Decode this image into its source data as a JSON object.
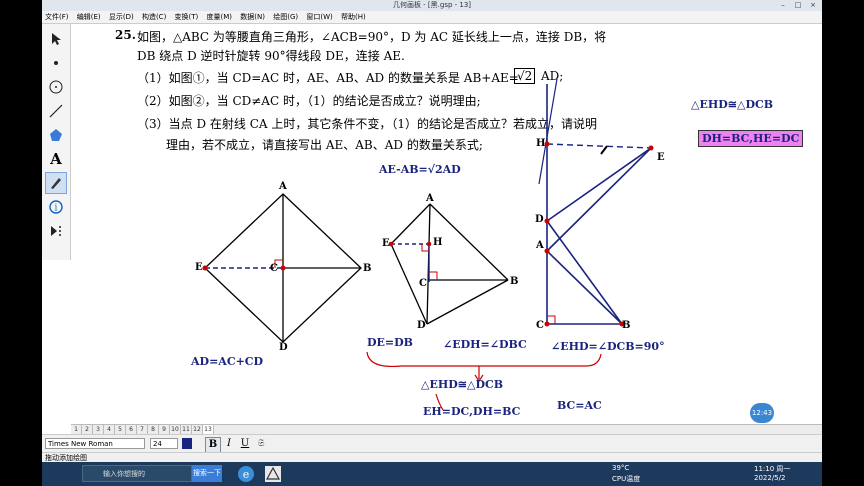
{
  "window": {
    "title": "几何画板 - [黑.gsp - 13]",
    "minimize": "–",
    "restore": "□",
    "close": "×"
  },
  "menu": [
    "文件(F)",
    "编辑(E)",
    "显示(D)",
    "构造(C)",
    "变换(T)",
    "度量(M)",
    "数据(N)",
    "绘图(G)",
    "窗口(W)",
    "帮助(H)"
  ],
  "tools": [
    "arrow-icon",
    "point-icon",
    "compass-icon",
    "line-icon",
    "polygon-icon",
    "text-icon",
    "marker-icon",
    "info-icon",
    "custom-tool-icon"
  ],
  "problem": {
    "number": "25.",
    "line1": "如图，△ABC 为等腰直角三角形，∠ACB=90°，D 为 AC 延长线上一点，连接 DB，将",
    "line2": "DB 绕点 D 逆时针旋转 90°得线段 DE，连接 AE.",
    "q1a": "（1）如图①，当 CD=AC 时，AE、AB、AD 的数量关系是 AB+AE=",
    "q1_answer": "√2",
    "q1b": "AD;",
    "q2": "（2）如图②，当 CD≠AC 时，（1）的结论是否成立？说明理由;",
    "q3a": "（3）当点 D 在射线 CA 上时，其它条件不变，（1）的结论是否成立？若成立，请说明",
    "q3b": "理由，若不成立，请直接写出 AE、AB、AD 的数量关系式;"
  },
  "notes": {
    "ae_ab": "AE-AB=√2AD",
    "ad": "AD=AC+CD",
    "de_db": "DE=DB",
    "edh_dbc": "∠EDH=∠DBC",
    "ehd_dcb_90": "∠EHD=∠DCB=90°",
    "ehd_cong_1": "△EHD≅△DCB",
    "eh_dc": "EH=DC,DH=BC",
    "bc_ac": "BC=AC",
    "ehd_cong_2": "△EHD≅△DCB",
    "highlight": "DH=BC,HE=DC"
  },
  "figure1": {
    "A": "A",
    "B": "B",
    "C": "C",
    "D": "D",
    "E": "E"
  },
  "figure2": {
    "A": "A",
    "H": "H",
    "E": "E",
    "C": "C",
    "B": "B",
    "D": "D"
  },
  "figure3": {
    "H": "H",
    "E": "E",
    "D": "D",
    "A": "A",
    "C": "C",
    "B": "B"
  },
  "page_tabs": [
    "1",
    "2",
    "3",
    "4",
    "5",
    "6",
    "7",
    "8",
    "9",
    "10",
    "11",
    "12",
    "13"
  ],
  "active_page": "13",
  "format": {
    "font": "Times New Roman",
    "size": "24",
    "bold": "B",
    "italic": "I",
    "underline": "U"
  },
  "status": "拖动添加绘图",
  "taskbar": {
    "search_placeholder": "输入你想搜的",
    "search_button": "搜索一下",
    "temperature": "39°C",
    "cpu_label": "CPU温度",
    "time": "11:10 周一",
    "date": "2022/5/2"
  },
  "time_bubble": "12:43",
  "colors": {
    "ink": "#000000",
    "handwriting": "#1a237e",
    "red": "#cc0000",
    "highlight": "#ee82ee"
  }
}
